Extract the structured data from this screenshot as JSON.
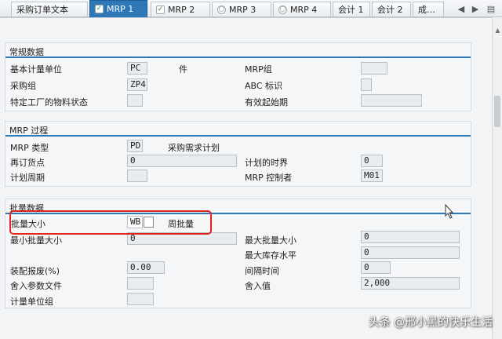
{
  "tabs": [
    {
      "label": "采购订单文本"
    },
    {
      "label": "MRP 1",
      "active": true,
      "icon": "check-icon"
    },
    {
      "label": "MRP 2",
      "icon": "check-icon"
    },
    {
      "label": "MRP 3",
      "icon": "status-circle-icon"
    },
    {
      "label": "MRP 4",
      "icon": "status-circle-icon"
    },
    {
      "label": "会计 1"
    },
    {
      "label": "会计 2"
    },
    {
      "label": "成…"
    }
  ],
  "groups": {
    "general": {
      "title": "常规数据",
      "base_uom_label": "基本计量单位",
      "base_uom_value": "PC",
      "base_uom_desc": "件",
      "mrp_group_label": "MRP组",
      "mrp_group_value": "",
      "purch_group_label": "采购组",
      "purch_group_value": "ZP4",
      "abc_label": "ABC 标识",
      "abc_value": "",
      "plant_status_label": "特定工厂的物料状态",
      "plant_status_value": "",
      "valid_from_label": "有效起始期",
      "valid_from_value": ""
    },
    "mrp": {
      "title": "MRP 过程",
      "mrp_type_label": "MRP 类型",
      "mrp_type_value": "PD",
      "mrp_type_desc": "采购需求计划",
      "reorder_label": "再订货点",
      "reorder_value": "0",
      "time_fence_label": "计划的时界",
      "time_fence_value": "0",
      "plan_cycle_label": "计划周期",
      "plan_cycle_value": "",
      "controller_label": "MRP 控制者",
      "controller_value": "M01"
    },
    "lot": {
      "title": "批量数据",
      "lot_size_label": "批量大小",
      "lot_size_value": "WB",
      "lot_size_desc": "周批量",
      "min_lot_label": "最小批量大小",
      "min_lot_value": "0",
      "max_lot_label": "最大批量大小",
      "max_lot_value": "0",
      "max_stock_label": "最大库存水平",
      "max_stock_value": "0",
      "scrap_label": "装配报废(%)",
      "scrap_value": "0.00",
      "interval_label": "间隔时间",
      "interval_value": "0",
      "rounding_profile_label": "舍入参数文件",
      "rounding_profile_value": "",
      "rounding_value_label": "舍入值",
      "rounding_value_value": "2,000",
      "uom_group_label": "计量单位组",
      "uom_group_value": ""
    }
  },
  "watermark": "头条 @邢小黑的快乐生活",
  "colors": {
    "accent": "#2f78b7",
    "highlight": "#e0261c"
  }
}
